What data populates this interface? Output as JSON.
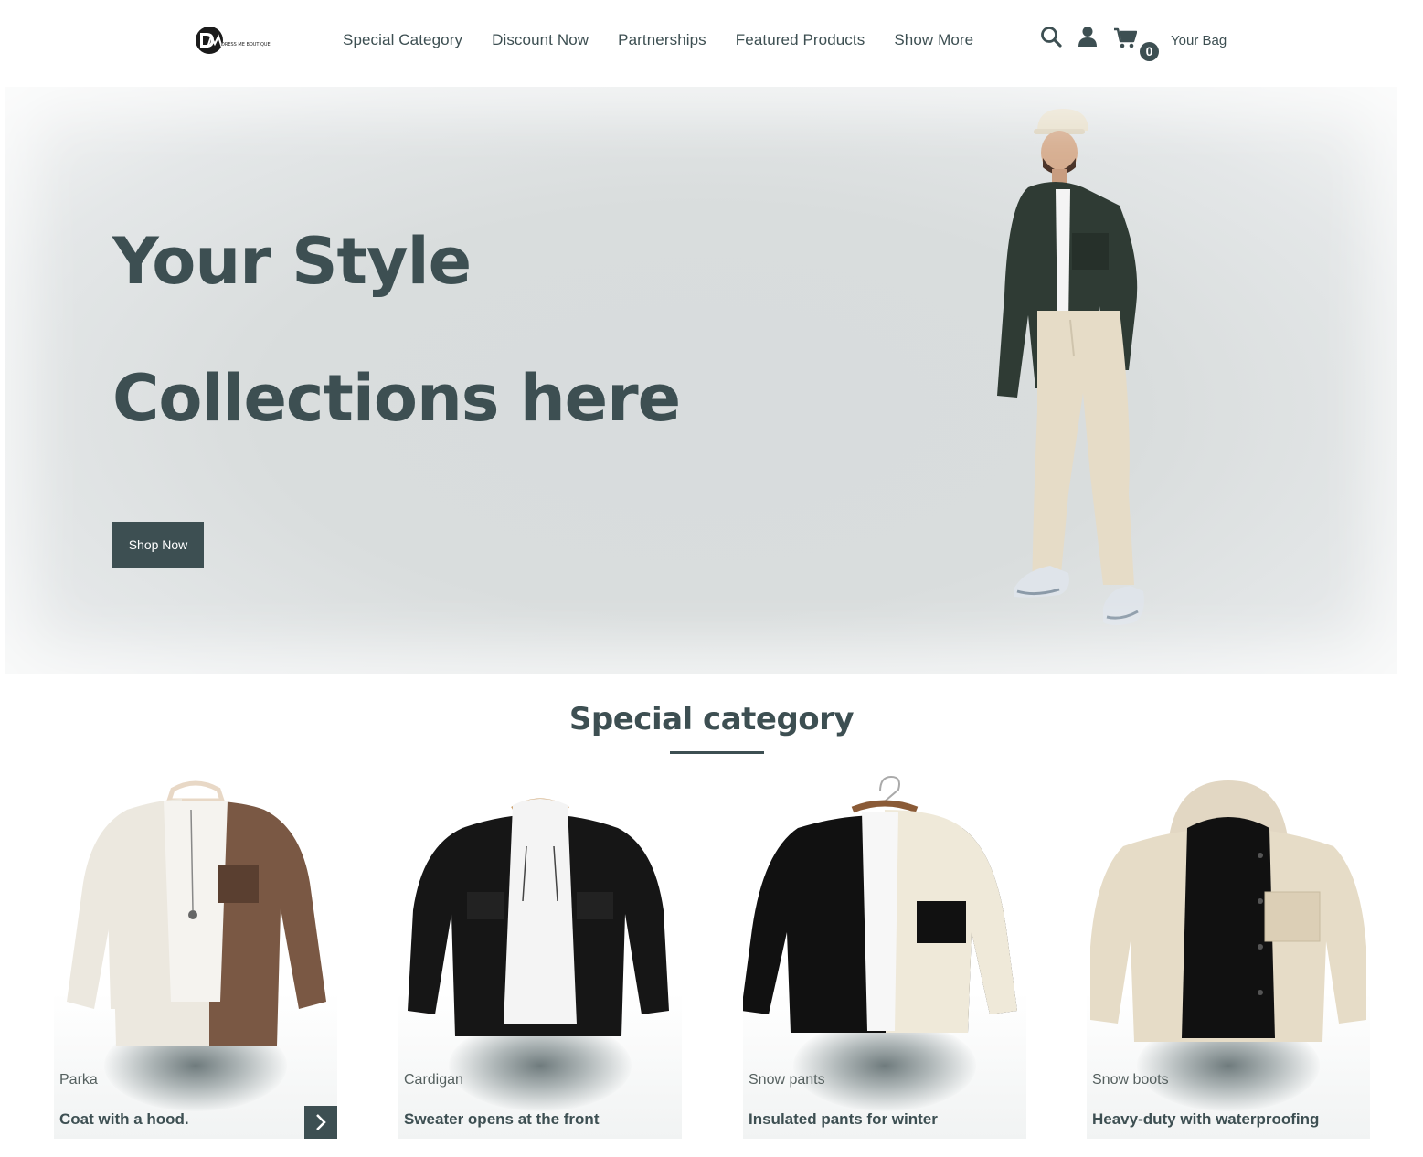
{
  "header": {
    "logo_mark": "DM",
    "logo_text": "DRESS ME BOUTIQUE",
    "nav": [
      "Special Category",
      "Discount Now",
      "Partnerships",
      "Featured Products",
      "Show More"
    ],
    "cart_count": "0",
    "bag_label": "Your Bag",
    "icons": [
      "search-icon",
      "user-icon",
      "cart-icon"
    ]
  },
  "hero": {
    "title_line1": "Your Style",
    "title_line2": "Collections here",
    "cta_label": "Shop Now"
  },
  "section": {
    "title": "Special category",
    "cards": [
      {
        "category": "Parka",
        "description": "Coat with a hood."
      },
      {
        "category": "Cardigan",
        "description": "Sweater opens at the front"
      },
      {
        "category": "Snow pants",
        "description": "Insulated pants for winter"
      },
      {
        "category": "Snow boots",
        "description": "Heavy-duty with waterproofing"
      }
    ]
  },
  "colors": {
    "accent": "#3d4f52",
    "hero_bg": "#d9dddd",
    "page_bg": "#ffffff"
  }
}
